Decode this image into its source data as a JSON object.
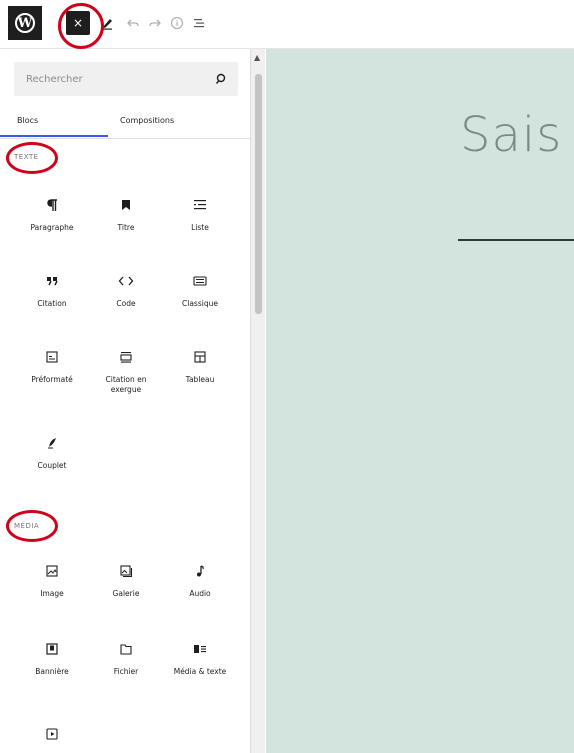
{
  "toolbar": {
    "logo": "W",
    "close_label": "×",
    "icons": [
      "wordpress-icon",
      "close-icon",
      "pencil-icon",
      "undo-icon",
      "redo-icon",
      "info-icon",
      "list-view-icon"
    ]
  },
  "inserter": {
    "search_placeholder": "Rechercher",
    "tabs": [
      {
        "label": "Blocs",
        "active": true
      },
      {
        "label": "Compositions",
        "active": false
      }
    ],
    "sections": [
      {
        "title": "TEXTE",
        "blocks": [
          {
            "label": "Paragraphe",
            "icon": "paragraph-icon"
          },
          {
            "label": "Titre",
            "icon": "bookmark-icon"
          },
          {
            "label": "Liste",
            "icon": "list-icon"
          },
          {
            "label": "Citation",
            "icon": "quote-icon"
          },
          {
            "label": "Code",
            "icon": "code-icon"
          },
          {
            "label": "Classique",
            "icon": "keyboard-icon"
          },
          {
            "label": "Préformaté",
            "icon": "preformatted-icon"
          },
          {
            "label": "Citation en exergue",
            "icon": "pullquote-icon"
          },
          {
            "label": "Tableau",
            "icon": "table-icon"
          },
          {
            "label": "Couplet",
            "icon": "quill-icon"
          }
        ]
      },
      {
        "title": "MÉDIA",
        "blocks": [
          {
            "label": "Image",
            "icon": "image-icon"
          },
          {
            "label": "Galerie",
            "icon": "gallery-icon"
          },
          {
            "label": "Audio",
            "icon": "audio-icon"
          },
          {
            "label": "Bannière",
            "icon": "cover-icon"
          },
          {
            "label": "Fichier",
            "icon": "folder-icon"
          },
          {
            "label": "Média & texte",
            "icon": "media-text-icon"
          },
          {
            "label": "",
            "icon": "video-icon"
          }
        ]
      }
    ]
  },
  "canvas": {
    "title_text": "Sais",
    "background": "#d3e3dd"
  },
  "colors": {
    "accent": "#3858e9",
    "annotation": "#d0021b",
    "dark": "#1e1e1e"
  }
}
